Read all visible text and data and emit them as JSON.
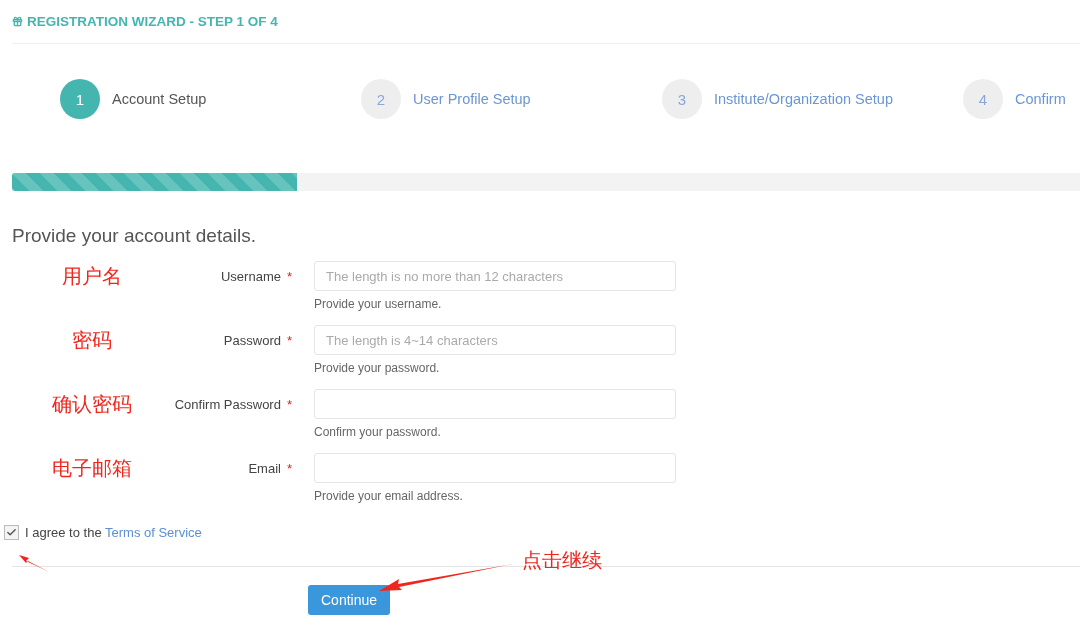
{
  "header": {
    "title": "REGISTRATION WIZARD - STEP 1 OF 4"
  },
  "steps": [
    {
      "number": "1",
      "label": "Account Setup",
      "selected": true
    },
    {
      "number": "2",
      "label": "User Profile Setup",
      "selected": false
    },
    {
      "number": "3",
      "label": "Institute/Organization Setup",
      "selected": false
    },
    {
      "number": "4",
      "label": "Confirm",
      "selected": false
    }
  ],
  "progress": {
    "level": 0.267
  },
  "form": {
    "heading": "Provide your account details.",
    "fields": [
      {
        "note": "用户名",
        "label": "Username",
        "required_mark": "*",
        "placeholder": "The length is no more than 12 characters",
        "help": "Provide your username."
      },
      {
        "note": "密码",
        "label": "Password",
        "required_mark": "*",
        "placeholder": "The length is 4~14 characters",
        "help": "Provide your password."
      },
      {
        "note": "确认密码",
        "label": "Confirm Password",
        "required_mark": "*",
        "help": "Confirm your password."
      },
      {
        "note": "电子邮箱",
        "label": "Email",
        "required_mark": "*",
        "help": "Provide your email address."
      }
    ],
    "agree": {
      "checked": true,
      "text": "I agree to the ",
      "link": "Terms of Service"
    },
    "continue_note": "点击继续",
    "button": "Continue"
  }
}
